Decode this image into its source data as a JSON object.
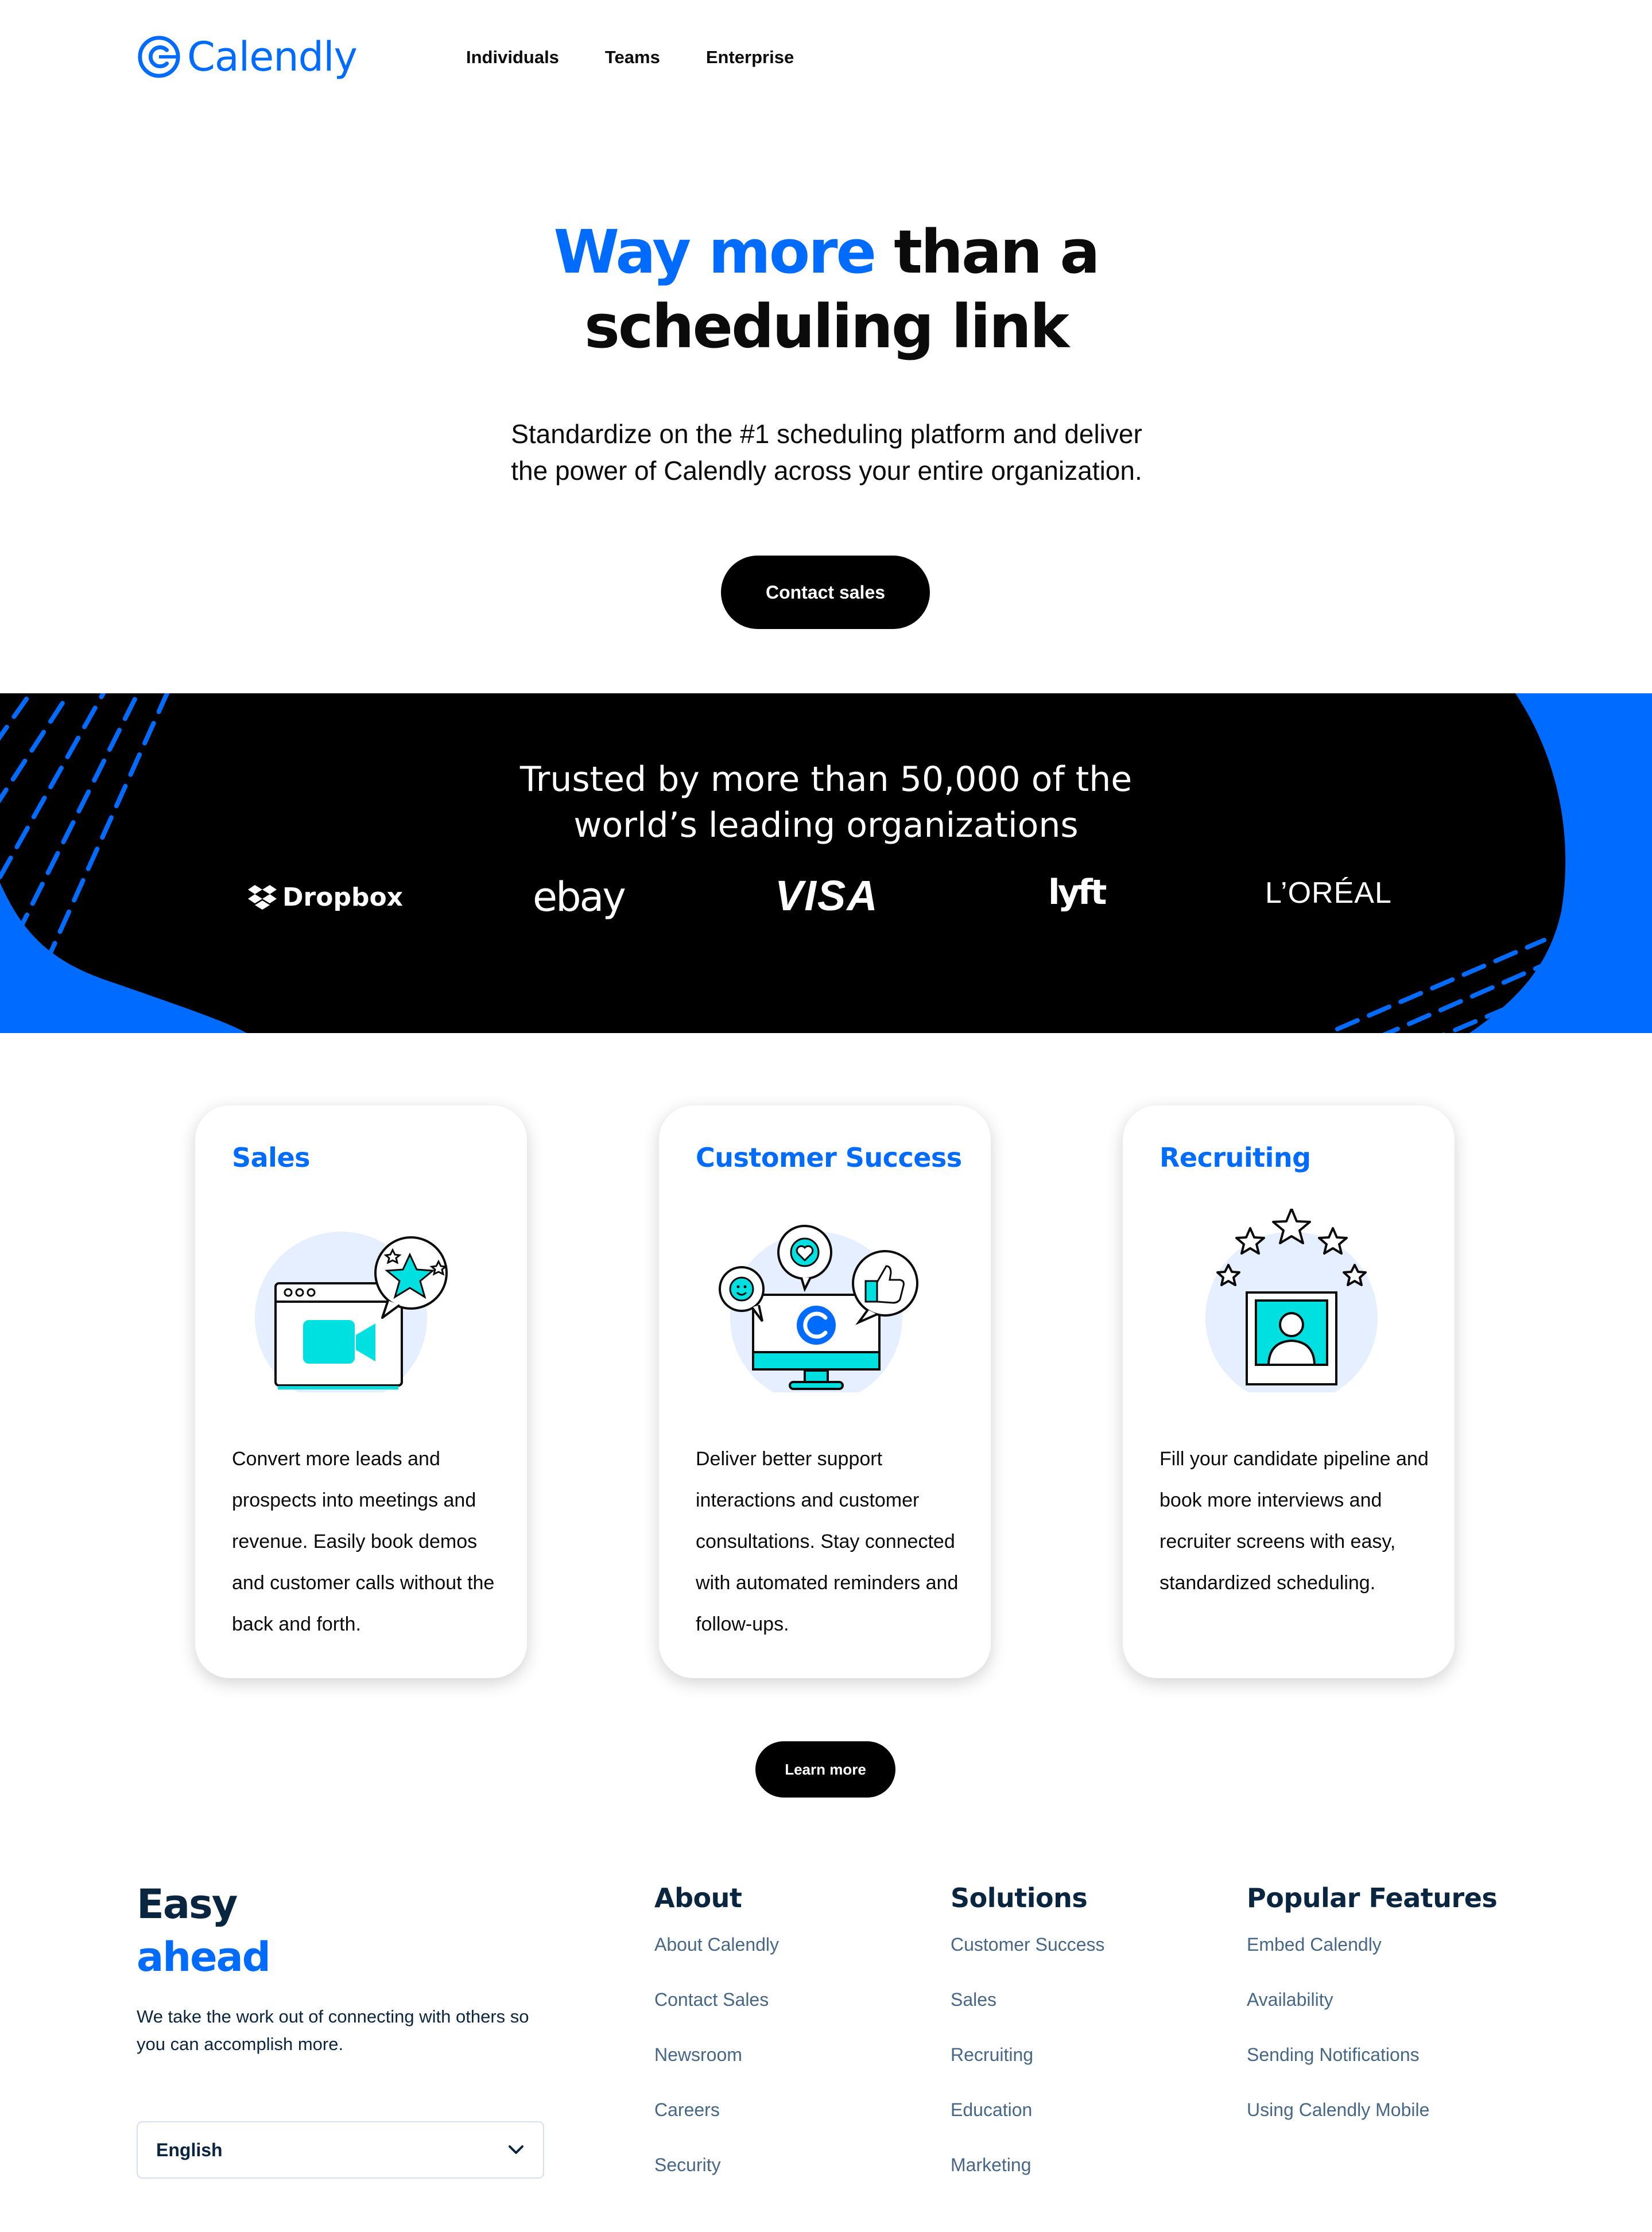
{
  "brand": {
    "name": "Calendly",
    "accent_color": "#006bff",
    "dark_color": "#0a2540"
  },
  "nav": {
    "items": [
      "Individuals",
      "Teams",
      "Enterprise"
    ]
  },
  "hero": {
    "title_accent": "Way more",
    "title_rest_line1": " than a",
    "title_line2": "scheduling link",
    "subtitle": "Standardize on the #1 scheduling platform and deliver the power of Calendly across your entire organization.",
    "cta": "Contact sales"
  },
  "trusted": {
    "title_line1": "Trusted by more than 50,000 of the",
    "title_line2": "world’s leading organizations",
    "logos": [
      "Dropbox",
      "ebay",
      "VISA",
      "lyft",
      "L’ORÉAL"
    ]
  },
  "cards": [
    {
      "title": "Sales",
      "icon": "video-call-icon",
      "body": "Convert more leads and prospects into meetings and revenue. Easily book demos and customer calls without the back and forth."
    },
    {
      "title": "Customer Success",
      "icon": "monitor-feedback-icon",
      "body": "Deliver better support interactions and customer consultations. Stay connected with automated reminders and follow-ups."
    },
    {
      "title": "Recruiting",
      "icon": "candidate-stars-icon",
      "body": "Fill your candidate pipeline and book more interviews and recruiter screens with easy, standardized scheduling."
    }
  ],
  "learn_more": "Learn more",
  "footer": {
    "heading_line1": "Easy",
    "heading_line2": "ahead",
    "tagline": "We take the work out of connecting with others so you can accomplish more.",
    "language": "English",
    "columns": [
      {
        "title": "About",
        "links": [
          "About Calendly",
          "Contact Sales",
          "Newsroom",
          "Careers",
          "Security"
        ]
      },
      {
        "title": "Solutions",
        "links": [
          "Customer Success",
          "Sales",
          "Recruiting",
          "Education",
          "Marketing"
        ]
      },
      {
        "title": "Popular Features",
        "links": [
          "Embed Calendly",
          "Availability",
          "Sending Notifications",
          "Using Calendly Mobile"
        ]
      }
    ]
  }
}
